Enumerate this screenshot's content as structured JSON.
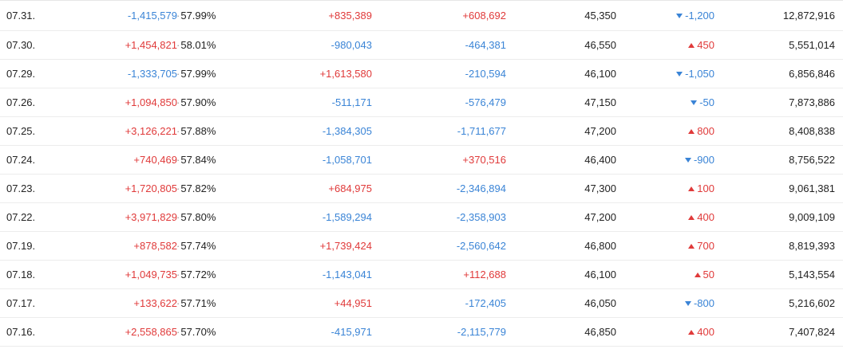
{
  "colors": {
    "up": "#e03a3a",
    "down": "#3a84d6",
    "text": "#222222",
    "divider": "#ececec"
  },
  "rows": [
    {
      "date": "07.31.",
      "foreign": "-1,415,579",
      "ratio": "57.99%",
      "institution": "+835,389",
      "individual": "+608,692",
      "close": "45,350",
      "change": "-1,200",
      "direction": "down",
      "volume": "12,872,916"
    },
    {
      "date": "07.30.",
      "foreign": "+1,454,821",
      "ratio": "58.01%",
      "institution": "-980,043",
      "individual": "-464,381",
      "close": "46,550",
      "change": "450",
      "direction": "up",
      "volume": "5,551,014"
    },
    {
      "date": "07.29.",
      "foreign": "-1,333,705",
      "ratio": "57.99%",
      "institution": "+1,613,580",
      "individual": "-210,594",
      "close": "46,100",
      "change": "-1,050",
      "direction": "down",
      "volume": "6,856,846"
    },
    {
      "date": "07.26.",
      "foreign": "+1,094,850",
      "ratio": "57.90%",
      "institution": "-511,171",
      "individual": "-576,479",
      "close": "47,150",
      "change": "-50",
      "direction": "down",
      "volume": "7,873,886"
    },
    {
      "date": "07.25.",
      "foreign": "+3,126,221",
      "ratio": "57.88%",
      "institution": "-1,384,305",
      "individual": "-1,711,677",
      "close": "47,200",
      "change": "800",
      "direction": "up",
      "volume": "8,408,838"
    },
    {
      "date": "07.24.",
      "foreign": "+740,469",
      "ratio": "57.84%",
      "institution": "-1,058,701",
      "individual": "+370,516",
      "close": "46,400",
      "change": "-900",
      "direction": "down",
      "volume": "8,756,522"
    },
    {
      "date": "07.23.",
      "foreign": "+1,720,805",
      "ratio": "57.82%",
      "institution": "+684,975",
      "individual": "-2,346,894",
      "close": "47,300",
      "change": "100",
      "direction": "up",
      "volume": "9,061,381"
    },
    {
      "date": "07.22.",
      "foreign": "+3,971,829",
      "ratio": "57.80%",
      "institution": "-1,589,294",
      "individual": "-2,358,903",
      "close": "47,200",
      "change": "400",
      "direction": "up",
      "volume": "9,009,109"
    },
    {
      "date": "07.19.",
      "foreign": "+878,582",
      "ratio": "57.74%",
      "institution": "+1,739,424",
      "individual": "-2,560,642",
      "close": "46,800",
      "change": "700",
      "direction": "up",
      "volume": "8,819,393"
    },
    {
      "date": "07.18.",
      "foreign": "+1,049,735",
      "ratio": "57.72%",
      "institution": "-1,143,041",
      "individual": "+112,688",
      "close": "46,100",
      "change": "50",
      "direction": "up",
      "volume": "5,143,554"
    },
    {
      "date": "07.17.",
      "foreign": "+133,622",
      "ratio": "57.71%",
      "institution": "+44,951",
      "individual": "-172,405",
      "close": "46,050",
      "change": "-800",
      "direction": "down",
      "volume": "5,216,602"
    },
    {
      "date": "07.16.",
      "foreign": "+2,558,865",
      "ratio": "57.70%",
      "institution": "-415,971",
      "individual": "-2,115,779",
      "close": "46,850",
      "change": "400",
      "direction": "up",
      "volume": "7,407,824"
    }
  ]
}
